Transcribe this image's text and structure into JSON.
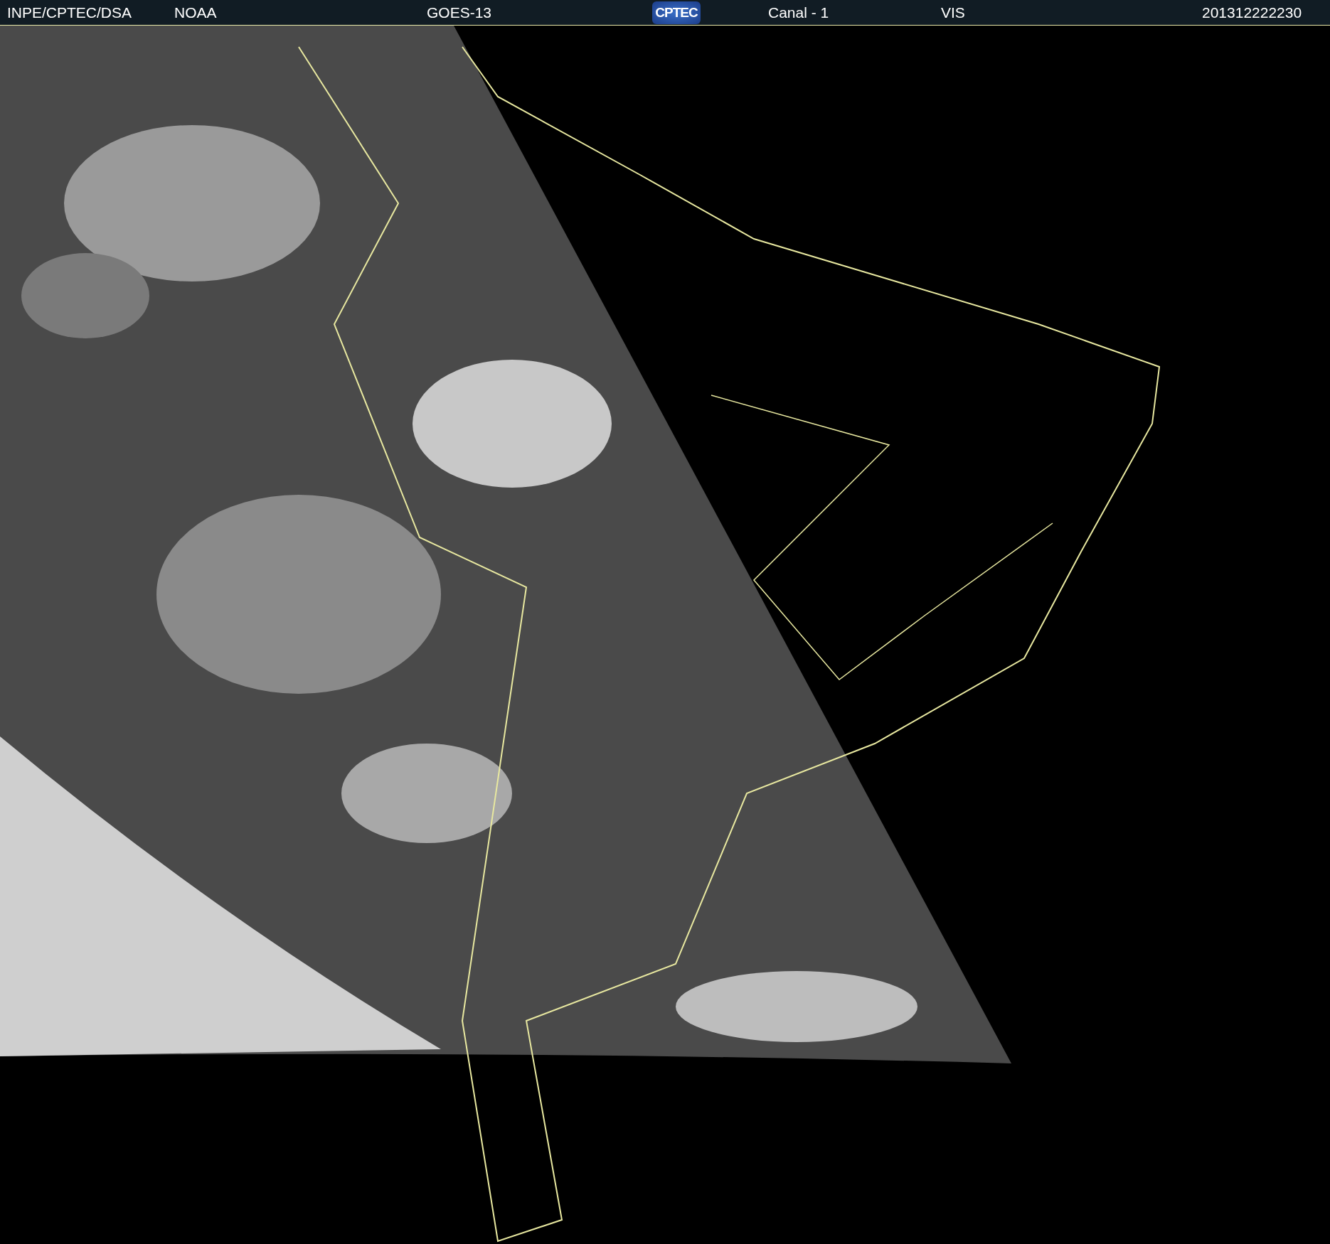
{
  "header": {
    "items": [
      {
        "kind": "text",
        "text": "INPE/CPTEC/DSA"
      },
      {
        "kind": "text",
        "text": "NOAA"
      },
      {
        "kind": "text",
        "text": "GOES-13"
      },
      {
        "kind": "logo",
        "text": "CPTEC"
      },
      {
        "kind": "text",
        "text": "Canal - 1"
      },
      {
        "kind": "text",
        "text": "VIS"
      },
      {
        "kind": "text",
        "text": "201312222230"
      }
    ]
  }
}
